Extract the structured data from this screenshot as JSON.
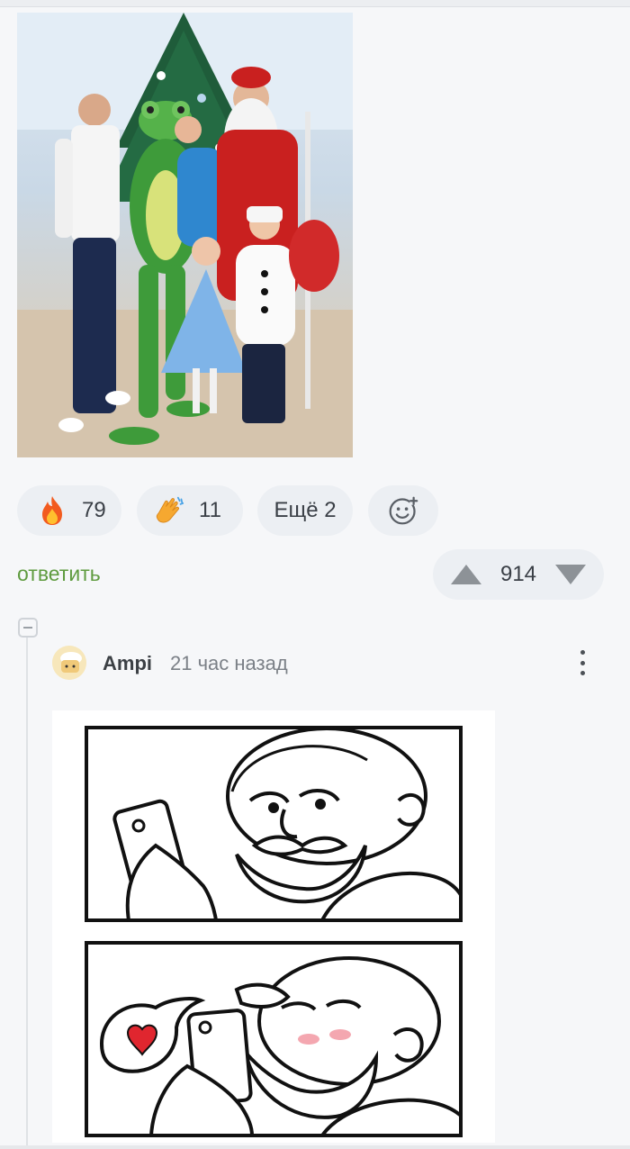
{
  "post": {
    "photo_alt": "group-photo",
    "reactions": [
      {
        "icon": "fire-icon",
        "count": "79"
      },
      {
        "icon": "clapping-hands-icon",
        "count": "11"
      }
    ],
    "more_reactions_label": "Ещё 2",
    "add_reaction_icon": "smiley-plus-icon"
  },
  "actions": {
    "reply_label": "ответить",
    "rating": "914"
  },
  "comment": {
    "author": "Ampi",
    "time": "21 час назад",
    "image": "comic-two-panels"
  },
  "colors": {
    "reply_green": "#5f9b3f",
    "pill_bg": "#eceff3",
    "page_bg": "#f6f7f9"
  }
}
